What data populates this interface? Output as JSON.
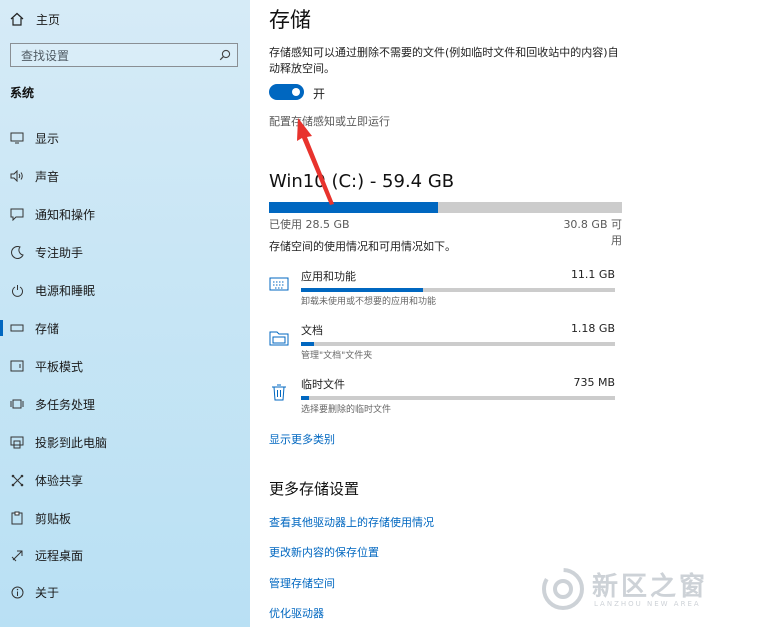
{
  "sidebar": {
    "home_label": "主页",
    "search_placeholder": "查找设置",
    "group_title": "系统",
    "items": [
      {
        "label": "显示",
        "icon": "display-icon"
      },
      {
        "label": "声音",
        "icon": "speaker-icon"
      },
      {
        "label": "通知和操作",
        "icon": "notification-icon"
      },
      {
        "label": "专注助手",
        "icon": "moon-icon"
      },
      {
        "label": "电源和睡眠",
        "icon": "power-icon"
      },
      {
        "label": "存储",
        "icon": "storage-icon",
        "active": true
      },
      {
        "label": "平板模式",
        "icon": "tablet-icon"
      },
      {
        "label": "多任务处理",
        "icon": "multitask-icon"
      },
      {
        "label": "投影到此电脑",
        "icon": "project-icon"
      },
      {
        "label": "体验共享",
        "icon": "share-icon"
      },
      {
        "label": "剪贴板",
        "icon": "clipboard-icon"
      },
      {
        "label": "远程桌面",
        "icon": "remote-icon"
      },
      {
        "label": "关于",
        "icon": "info-icon"
      }
    ]
  },
  "main": {
    "title": "存储",
    "description": "存储感知可以通过删除不需要的文件(例如临时文件和回收站中的内容)自动释放空间。",
    "toggle_label": "开",
    "toggle_on": true,
    "config_link": "配置存储感知或立即运行",
    "drive": {
      "title": "Win10 (C:) - 59.4 GB",
      "used_label": "已使用 28.5 GB",
      "free_label": "30.8 GB 可用",
      "used_fraction": 0.48,
      "description": "存储空间的使用情况和可用情况如下。"
    },
    "categories": [
      {
        "name": "应用和功能",
        "size": "11.1 GB",
        "sub": "卸载未使用或不想要的应用和功能",
        "fraction": 0.39,
        "icon": "keyboard-icon"
      },
      {
        "name": "文档",
        "size": "1.18 GB",
        "sub": "管理\"文档\"文件夹",
        "fraction": 0.04,
        "icon": "folder-icon"
      },
      {
        "name": "临时文件",
        "size": "735 MB",
        "sub": "选择要删除的临时文件",
        "fraction": 0.025,
        "icon": "trash-icon"
      }
    ],
    "show_more": "显示更多类别",
    "more_title": "更多存储设置",
    "more_links": [
      "查看其他驱动器上的存储使用情况",
      "更改新内容的保存位置",
      "管理存储空间",
      "优化驱动器"
    ]
  },
  "watermark": {
    "text": "新区之窗",
    "sub": "LANZHOU NEW AREA"
  },
  "colors": {
    "accent": "#0067c0",
    "annotation": "#e8332d"
  }
}
